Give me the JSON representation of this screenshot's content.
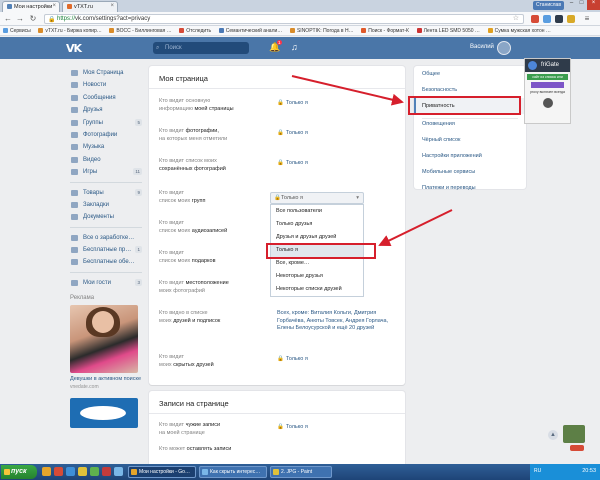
{
  "browser": {
    "tabs": [
      {
        "label": "Мои настройки",
        "active": true
      },
      {
        "label": "vTXT.ru",
        "active": false
      }
    ],
    "window_user": "Станислав",
    "url_scheme": "https://",
    "url_rest": "vk.com/settings?act=privacy",
    "bookmarks": [
      "Сервисы",
      "vTXT.ru - Биржа копир…",
      "ВОСС - Биллинговая …",
      "Отследить",
      "Семантический анали…",
      "SINOPTIK: Погода в Н…",
      "Поиск - Формат-К",
      "Лента LED SMD 5050 …",
      "Сумка мужская хотон …"
    ]
  },
  "vk": {
    "search_placeholder": "Поиск",
    "bell_badge": "1",
    "user_name": "Василий"
  },
  "left_menu": {
    "items": [
      {
        "label": "Моя Страница",
        "count": ""
      },
      {
        "label": "Новости",
        "count": ""
      },
      {
        "label": "Сообщения",
        "count": ""
      },
      {
        "label": "Друзья",
        "count": ""
      },
      {
        "label": "Группы",
        "count": "5"
      },
      {
        "label": "Фотографии",
        "count": ""
      },
      {
        "label": "Музыка",
        "count": ""
      },
      {
        "label": "Видео",
        "count": ""
      },
      {
        "label": "Игры",
        "count": "11"
      }
    ],
    "items2": [
      {
        "label": "Товары",
        "count": "9"
      },
      {
        "label": "Закладки",
        "count": ""
      },
      {
        "label": "Документы",
        "count": ""
      }
    ],
    "items3": [
      {
        "label": "Все о заработке…",
        "count": ""
      },
      {
        "label": "Бесплатные пр…",
        "count": "1"
      },
      {
        "label": "Бесплатные обе…",
        "count": ""
      }
    ],
    "items4": [
      {
        "label": "Мои гости",
        "count": "3"
      }
    ],
    "ads_label": "Реклама",
    "ad_title": "Девушки в активном поиске",
    "ad_source": "vnedate.com"
  },
  "privacy": {
    "section_title": "Моя страница",
    "rows": [
      {
        "label1": "Кто видит основную",
        "label2": "информацию ",
        "label_b": "моей страницы",
        "value": "Только я"
      },
      {
        "label1": "Кто видит ",
        "label_b1": "фотографии,",
        "label2": "на которых меня отметили",
        "value": "Только я"
      },
      {
        "label1": "Кто видит список моих",
        "label2": "",
        "label_b": "сохранённых фотографий",
        "value": "Только я"
      },
      {
        "label1": "Кто видит",
        "label2": "список моих ",
        "label_b": "групп",
        "value": "Только я"
      },
      {
        "label1": "Кто видит",
        "label2": "список моих ",
        "label_b": "аудиозаписей",
        "value": ""
      },
      {
        "label1": "Кто видит",
        "label2": "список моих ",
        "label_b": "подарков",
        "value": ""
      },
      {
        "label1": "Кто видит ",
        "label_b1": "местоположение",
        "label2": "моих фотографий",
        "value": ""
      },
      {
        "label1": "Кто видно в списке",
        "label2": "моих ",
        "label_b": "друзей и подписок",
        "value": "Всех, кроме: Виталия Кольги, Дмитрия Горбачёва, Анюты Товсек, Андрея Горлача, Елены Белоусурской и ещё 20 друзей"
      },
      {
        "label1": "Кто видит",
        "label2": "моих ",
        "label_b": "скрытых друзей",
        "value": "Только я"
      }
    ],
    "dropdown": {
      "selected": "Только я",
      "options": [
        "Все пользователи",
        "Только друзья",
        "Друзья и друзья друзей",
        "Только я",
        "Все, кроме…",
        "Некоторые друзья",
        "Некоторые списки друзей"
      ]
    },
    "section2_title": "Записи на странице",
    "rows2": [
      {
        "label1": "Кто видит ",
        "label_b1": "чужие записи",
        "label2": "на моей странице",
        "value": "Только я"
      },
      {
        "label1": "Кто может ",
        "label_b1": "оставлять записи",
        "label2": "",
        "value": ""
      }
    ]
  },
  "settings_menu": {
    "items": [
      "Общее",
      "Безопасность",
      "Приватность",
      "Оповещения",
      "Чёрный список",
      "Настройки приложений",
      "Мобильные сервисы",
      "Платежи и переводы"
    ],
    "active_index": 2
  },
  "frigate": {
    "title": "friGate",
    "green_text": "сайт из списка или",
    "text": "proxy включен всегда"
  },
  "taskbar": {
    "start_label": "пуск",
    "tasks": [
      "Мои настройки - Go…",
      "Как скрыть интерес…",
      "2. JPG - Paint"
    ],
    "lang": "RU",
    "time": "20:53"
  },
  "colors": {
    "vk_blue": "#4a76a8",
    "link_blue": "#2a5885",
    "highlight_red": "#d61f2c"
  }
}
